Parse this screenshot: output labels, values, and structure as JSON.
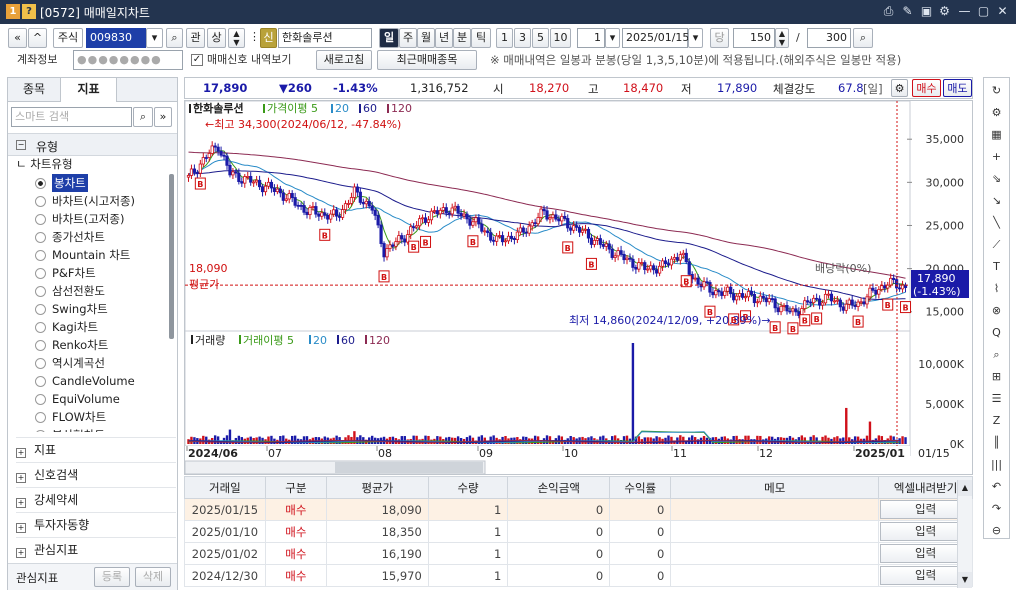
{
  "window": {
    "badge_a": "1",
    "badge_b": "?",
    "title": "[0572] 매매일지차트",
    "controls": [
      "⎙",
      "✎",
      "▣",
      "⚙",
      "—",
      "▢",
      "✕"
    ]
  },
  "toolbar": {
    "market_select": "주식",
    "code_value": "009830",
    "kwan_label": "관",
    "sang_label": "상",
    "new_badge": "신",
    "stock_name": "한화솔루션",
    "periods": [
      "일",
      "주",
      "월",
      "년",
      "분",
      "틱"
    ],
    "minute_options": [
      "1",
      "3",
      "5",
      "10"
    ],
    "count_value": "1",
    "date_value": "2025/01/15",
    "dang_label": "당",
    "bars_value": "150",
    "slash": "/",
    "total_value": "300",
    "account_label": "계좌정보",
    "account_value": "●●●●●●●●",
    "checkbox_label": "매매신호 내역보기",
    "refresh_button": "새로고침",
    "recent_button": "최근매매종목",
    "note": "※ 매매내역은 일봉과 분봉(당일 1,3,5,10분)에 적용됩니다.(해외주식은 일봉만 적용)"
  },
  "left_panel": {
    "tabs": [
      "종목",
      "지표"
    ],
    "search_placeholder": "스마트 검색",
    "section_title": "유형",
    "subsection": "차트유형",
    "chart_types": [
      "봉차트",
      "바차트(시고저종)",
      "바차트(고저종)",
      "종가선차트",
      "Mountain 차트",
      "P&F차트",
      "삼선전환도",
      "Swing차트",
      "Kagi차트",
      "Renko차트",
      "역시계곡선",
      "CandleVolume",
      "EquiVolume",
      "FLOW차트",
      "분산형차트"
    ],
    "selected_index": 0,
    "groups": [
      "지표",
      "신호검색",
      "강세약세",
      "투자자동향",
      "관심지표"
    ],
    "footer_label": "관심지표",
    "register_button": "등록",
    "delete_button": "삭제"
  },
  "quote": {
    "price": "17,890",
    "change": "▼260",
    "rate": "-1.43%",
    "volume": "1,316,752",
    "open_label": "시",
    "open": "18,270",
    "high_label": "고",
    "high": "18,470",
    "low_label": "저",
    "low": "17,890",
    "strength_label": "체결강도",
    "strength": "67.8",
    "period_tag": "[일]",
    "buy_button": "매수",
    "sell_button": "매도"
  },
  "chart": {
    "price_legend": [
      "한화솔루션",
      "가격이평 5",
      "20",
      "60",
      "120"
    ],
    "volume_legend": [
      "거래량",
      "거래이평 5",
      "20",
      "60",
      "120"
    ],
    "max_note": "←최고 34,300(2024/06/12, -47.84%)",
    "min_note": "최저 14,860(2024/12/09, +20.39%)→",
    "avg_value_label": "18,090",
    "avg_label": "평균가",
    "trend_label": "배당락(0%)",
    "current_price_tag": "17,890",
    "current_rate_tag": "(-1.43%)",
    "price_axis": [
      "35,000",
      "30,000",
      "25,000",
      "20,000",
      "15,000"
    ],
    "volume_axis": [
      "10,000K",
      "5,000K",
      "0K"
    ],
    "month_labels": [
      "2024/06",
      "07",
      "08",
      "09",
      "10",
      "11",
      "12",
      "2025/01"
    ],
    "end_date": "01/15",
    "colors": {
      "up": "#d0101a",
      "down": "#1a1aa8",
      "ma5": "#3a9a18",
      "ma20": "#2a8cc8",
      "ma60": "#1c1c8c",
      "ma120": "#8c2a52",
      "signal": "#d01010"
    }
  },
  "chart_data": {
    "type": "line",
    "title": "한화솔루션",
    "ylim": [
      13000,
      38500
    ],
    "series": [
      {
        "name": "한화솔루션",
        "x": [
          "2024/06/03",
          "2024/06/12",
          "2024/07/01",
          "2024/07/15",
          "2024/08/01",
          "2024/08/05",
          "2024/08/20",
          "2024/09/02",
          "2024/09/20",
          "2024/10/02",
          "2024/10/21",
          "2024/11/01",
          "2024/11/15",
          "2024/11/25",
          "2024/12/09",
          "2024/12/20",
          "2024/12/30",
          "2025/01/15"
        ],
        "values": [
          30500,
          34300,
          30000,
          26700,
          28800,
          22000,
          26000,
          26000,
          23200,
          26500,
          22600,
          20000,
          21800,
          17000,
          14860,
          16600,
          15970,
          17890
        ]
      }
    ],
    "volume_max_k": 12600
  },
  "table": {
    "headers": [
      "거래일",
      "구분",
      "평균가",
      "수량",
      "손익금액",
      "수익률",
      "메모",
      "엑셀내려받기"
    ],
    "rows": [
      {
        "date": "2025/01/15",
        "type": "매수",
        "avg": "18,090",
        "qty": "1",
        "pl": "0",
        "rate": "0",
        "memo": "",
        "action": "입력"
      },
      {
        "date": "2025/01/10",
        "type": "매수",
        "avg": "18,350",
        "qty": "1",
        "pl": "0",
        "rate": "0",
        "memo": "",
        "action": "입력"
      },
      {
        "date": "2025/01/02",
        "type": "매수",
        "avg": "16,190",
        "qty": "1",
        "pl": "0",
        "rate": "0",
        "memo": "",
        "action": "입력"
      },
      {
        "date": "2024/12/30",
        "type": "매수",
        "avg": "15,970",
        "qty": "1",
        "pl": "0",
        "rate": "0",
        "memo": "",
        "action": "입력"
      }
    ]
  },
  "right_toolbar": [
    "↻",
    "⚙",
    "▦",
    "+",
    "⇘",
    "↘",
    "╲",
    "⟋",
    "T",
    "⌇",
    "⊗",
    "Q",
    "⌕",
    "⊞",
    "☰",
    "Z",
    "║",
    "|||",
    "↶",
    "↷",
    "⊖"
  ]
}
